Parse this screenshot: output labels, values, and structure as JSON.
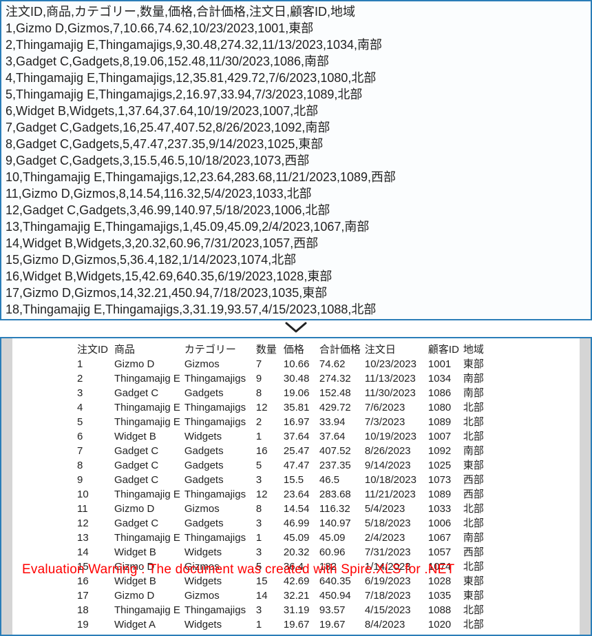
{
  "csv": {
    "header": "注文ID,商品,カテゴリー,数量,価格,合計価格,注文日,顧客ID,地域",
    "rows": [
      "1,Gizmo D,Gizmos,7,10.66,74.62,10/23/2023,1001,東部",
      "2,Thingamajig E,Thingamajigs,9,30.48,274.32,11/13/2023,1034,南部",
      "3,Gadget C,Gadgets,8,19.06,152.48,11/30/2023,1086,南部",
      "4,Thingamajig E,Thingamajigs,12,35.81,429.72,7/6/2023,1080,北部",
      "5,Thingamajig E,Thingamajigs,2,16.97,33.94,7/3/2023,1089,北部",
      "6,Widget B,Widgets,1,37.64,37.64,10/19/2023,1007,北部",
      "7,Gadget C,Gadgets,16,25.47,407.52,8/26/2023,1092,南部",
      "8,Gadget C,Gadgets,5,47.47,237.35,9/14/2023,1025,東部",
      "9,Gadget C,Gadgets,3,15.5,46.5,10/18/2023,1073,西部",
      "10,Thingamajig E,Thingamajigs,12,23.64,283.68,11/21/2023,1089,西部",
      "11,Gizmo D,Gizmos,8,14.54,116.32,5/4/2023,1033,北部",
      "12,Gadget C,Gadgets,3,46.99,140.97,5/18/2023,1006,北部",
      "13,Thingamajig E,Thingamajigs,1,45.09,45.09,2/4/2023,1067,南部",
      "14,Widget B,Widgets,3,20.32,60.96,7/31/2023,1057,西部",
      "15,Gizmo D,Gizmos,5,36.4,182,1/14/2023,1074,北部",
      "16,Widget B,Widgets,15,42.69,640.35,6/19/2023,1028,東部",
      "17,Gizmo D,Gizmos,14,32.21,450.94,7/18/2023,1035,東部",
      "18,Thingamajig E,Thingamajigs,3,31.19,93.57,4/15/2023,1088,北部"
    ]
  },
  "table": {
    "headers": [
      "注文ID",
      "商品",
      "カテゴリー",
      "数量",
      "価格",
      "合計価格",
      "注文日",
      "顧客ID",
      "地域"
    ],
    "rows": [
      [
        "1",
        "Gizmo D",
        "Gizmos",
        "7",
        "10.66",
        "74.62",
        "10/23/2023",
        "1001",
        "東部"
      ],
      [
        "2",
        "Thingamajig E",
        "Thingamajigs",
        "9",
        "30.48",
        "274.32",
        "11/13/2023",
        "1034",
        "南部"
      ],
      [
        "3",
        "Gadget C",
        "Gadgets",
        "8",
        "19.06",
        "152.48",
        "11/30/2023",
        "1086",
        "南部"
      ],
      [
        "4",
        "Thingamajig E",
        "Thingamajigs",
        "12",
        "35.81",
        "429.72",
        "7/6/2023",
        "1080",
        "北部"
      ],
      [
        "5",
        "Thingamajig E",
        "Thingamajigs",
        "2",
        "16.97",
        "33.94",
        "7/3/2023",
        "1089",
        "北部"
      ],
      [
        "6",
        "Widget B",
        "Widgets",
        "1",
        "37.64",
        "37.64",
        "10/19/2023",
        "1007",
        "北部"
      ],
      [
        "7",
        "Gadget C",
        "Gadgets",
        "16",
        "25.47",
        "407.52",
        "8/26/2023",
        "1092",
        "南部"
      ],
      [
        "8",
        "Gadget C",
        "Gadgets",
        "5",
        "47.47",
        "237.35",
        "9/14/2023",
        "1025",
        "東部"
      ],
      [
        "9",
        "Gadget C",
        "Gadgets",
        "3",
        "15.5",
        "46.5",
        "10/18/2023",
        "1073",
        "西部"
      ],
      [
        "10",
        "Thingamajig E",
        "Thingamajigs",
        "12",
        "23.64",
        "283.68",
        "11/21/2023",
        "1089",
        "西部"
      ],
      [
        "11",
        "Gizmo D",
        "Gizmos",
        "8",
        "14.54",
        "116.32",
        "5/4/2023",
        "1033",
        "北部"
      ],
      [
        "12",
        "Gadget C",
        "Gadgets",
        "3",
        "46.99",
        "140.97",
        "5/18/2023",
        "1006",
        "北部"
      ],
      [
        "13",
        "Thingamajig E",
        "Thingamajigs",
        "1",
        "45.09",
        "45.09",
        "2/4/2023",
        "1067",
        "南部"
      ],
      [
        "14",
        "Widget B",
        "Widgets",
        "3",
        "20.32",
        "60.96",
        "7/31/2023",
        "1057",
        "西部"
      ],
      [
        "15",
        "Gizmo D",
        "Gizmos",
        "5",
        "36.4",
        "182",
        "1/14/2023",
        "1074",
        "北部"
      ],
      [
        "16",
        "Widget B",
        "Widgets",
        "15",
        "42.69",
        "640.35",
        "6/19/2023",
        "1028",
        "東部"
      ],
      [
        "17",
        "Gizmo D",
        "Gizmos",
        "14",
        "32.21",
        "450.94",
        "7/18/2023",
        "1035",
        "東部"
      ],
      [
        "18",
        "Thingamajig E",
        "Thingamajigs",
        "3",
        "31.19",
        "93.57",
        "4/15/2023",
        "1088",
        "北部"
      ],
      [
        "19",
        "Widget A",
        "Widgets",
        "1",
        "19.67",
        "19.67",
        "8/4/2023",
        "1020",
        "北部"
      ]
    ]
  },
  "watermark": "Evaluation Warning : The document was created with Spire.XLS for .NET"
}
